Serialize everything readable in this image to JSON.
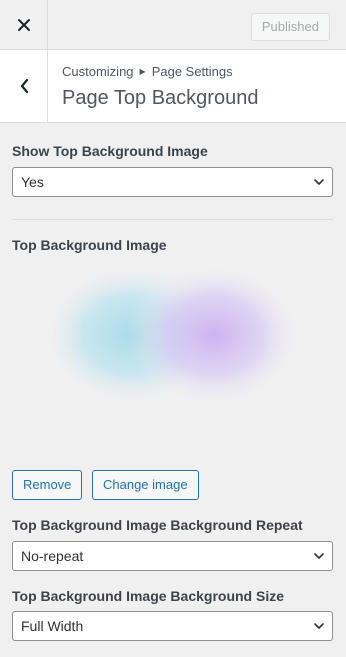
{
  "topbar": {
    "close_icon": "close-icon",
    "publish_label": "Published"
  },
  "header": {
    "back_icon": "chevron-left-icon",
    "breadcrumb": [
      "Customizing",
      "Page Settings"
    ],
    "breadcrumb_separator_icon": "triangle-right-icon",
    "title": "Page Top Background"
  },
  "controls": {
    "show_image": {
      "label": "Show Top Background Image",
      "value": "Yes"
    },
    "image": {
      "label": "Top Background Image",
      "remove_label": "Remove",
      "change_label": "Change image"
    },
    "repeat": {
      "label": "Top Background Image Background Repeat",
      "value": "No-repeat"
    },
    "size": {
      "label": "Top Background Image Background Size",
      "value": "Full Width"
    }
  },
  "colors": {
    "accent": "#2271b1",
    "panel_bg": "#f0f0f1",
    "preview_blob_left": "#a8dbe8",
    "preview_blob_right": "#cbb3f2"
  }
}
